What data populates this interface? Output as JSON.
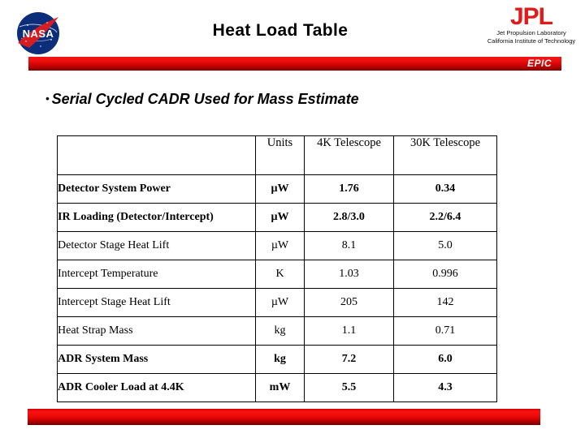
{
  "header": {
    "title": "Heat Load Table",
    "nasa_logo_alt": "NASA",
    "jpl": {
      "wordmark": "JPL",
      "line1": "Jet Propulsion Laboratory",
      "line2": "California Institute of Technology"
    },
    "banner_label": "EPIC"
  },
  "bullet": {
    "marker": "•",
    "text": "Serial Cycled CADR Used for Mass Estimate"
  },
  "table": {
    "columns": [
      "",
      "Units",
      "4K Telescope",
      "30K Telescope"
    ],
    "rows": [
      {
        "label": "Detector System Power",
        "units": "µW",
        "c4k": "1.76",
        "c30k": "0.34",
        "bold": true
      },
      {
        "label": "IR Loading (Detector/Intercept)",
        "units": "µW",
        "c4k": "2.8/3.0",
        "c30k": "2.2/6.4",
        "bold": true
      },
      {
        "label": "Detector Stage Heat Lift",
        "units": "µW",
        "c4k": "8.1",
        "c30k": "5.0",
        "bold": false
      },
      {
        "label": "Intercept Temperature",
        "units": "K",
        "c4k": "1.03",
        "c30k": "0.996",
        "bold": false
      },
      {
        "label": "Intercept Stage Heat Lift",
        "units": "µW",
        "c4k": "205",
        "c30k": "142",
        "bold": false
      },
      {
        "label": "Heat Strap Mass",
        "units": "kg",
        "c4k": "1.1",
        "c30k": "0.71",
        "bold": false
      },
      {
        "label": "ADR System Mass",
        "units": "kg",
        "c4k": "7.2",
        "c30k": "6.0",
        "bold": true
      },
      {
        "label": "ADR Cooler Load at 4.4K",
        "units": "mW",
        "c4k": "5.5",
        "c30k": "4.3",
        "bold": true
      }
    ]
  },
  "colors": {
    "banner_red": "#e40606",
    "nasa_blue": "#0b2d7a",
    "jpl_red": "#e01b1b"
  }
}
